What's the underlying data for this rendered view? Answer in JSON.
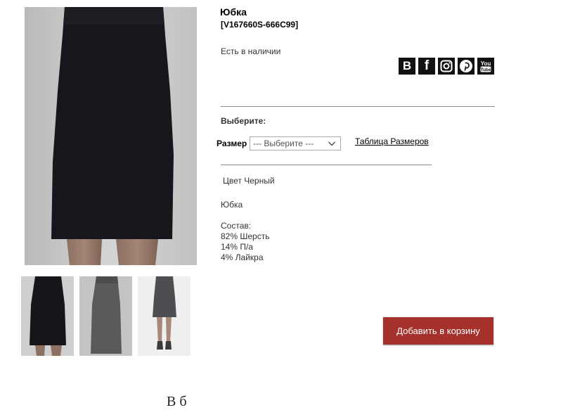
{
  "product": {
    "title": "Юбка",
    "sku": "[V167660S-666C99]",
    "stock_status": "Есть в наличии"
  },
  "social": [
    {
      "name": "vk",
      "label": "B"
    },
    {
      "name": "facebook",
      "label": "f"
    },
    {
      "name": "instagram",
      "label": ""
    },
    {
      "name": "pinterest",
      "label": ""
    },
    {
      "name": "youtube",
      "label": ""
    }
  ],
  "options": {
    "choose_label": "Выберите:",
    "size_label": "Размер",
    "size_placeholder": "--- Выберите ---",
    "size_table_link": "Таблица Размеров"
  },
  "description": {
    "color": "Цвет Черный",
    "name": "Юбка",
    "composition_heading": "Состав:",
    "composition": [
      "82% Шерсть",
      "14% П/а",
      "4% Лайкра"
    ]
  },
  "cart": {
    "button_label": "Добавить в корзину"
  },
  "bottom": {
    "heading_partial": "В       б"
  },
  "colors": {
    "button": "#a5312c",
    "skirt_black": "#16161c",
    "skirt_grey": "#5a5a5c"
  }
}
